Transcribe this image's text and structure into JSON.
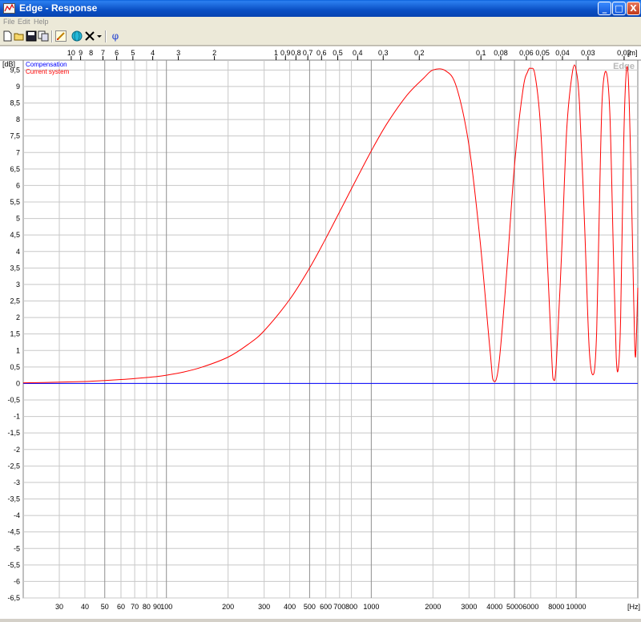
{
  "window": {
    "title": "Edge - Response",
    "min_label": "_",
    "max_label": "□",
    "close_label": "X"
  },
  "menu": {
    "items": [
      "File",
      "Edit",
      "Help"
    ]
  },
  "toolbar": {
    "icons": [
      "new-file-icon",
      "open-folder-icon",
      "save-icon",
      "copy-icon",
      "pencil-icon",
      "globe-icon",
      "cross-icon",
      "dropdown-arrow-icon",
      "phi-icon"
    ],
    "phi_label": "φ"
  },
  "colors": {
    "compensation": "#0000ff",
    "current": "#ff0000",
    "grid": "#c8c8c8",
    "grid_major": "#909090"
  },
  "chart_data": {
    "type": "line",
    "watermark": "Edge",
    "x_unit_label": "[Hz]",
    "y_unit_label": "[dB]",
    "top_unit_label": "[m]",
    "xscale": "log",
    "xlim": [
      20,
      20000
    ],
    "ylim": [
      -6.5,
      9.8
    ],
    "grid": true,
    "legend_position": "top-left",
    "legend": [
      "Compensation",
      "Current system"
    ],
    "x_ticks": [
      30,
      40,
      50,
      60,
      70,
      80,
      90,
      100,
      200,
      300,
      400,
      500,
      600,
      700,
      800,
      1000,
      2000,
      3000,
      4000,
      5000,
      6000,
      8000,
      10000
    ],
    "x_tick_labels": [
      "30",
      "40",
      "50",
      "60",
      "70",
      "80",
      "90",
      "100",
      "200",
      "300",
      "400",
      "500",
      "600",
      "700",
      "800",
      "1000",
      "2000",
      "3000",
      "4000",
      "5000",
      "6000",
      "8000",
      "10000"
    ],
    "y_ticks": [
      -6.5,
      -6,
      -5.5,
      -5,
      -4.5,
      -4,
      -3.5,
      -3,
      -2.5,
      -2,
      -1.5,
      -1,
      -0.5,
      0,
      0.5,
      1,
      1.5,
      2,
      2.5,
      3,
      3.5,
      4,
      4.5,
      5,
      5.5,
      6,
      6.5,
      7,
      7.5,
      8,
      8.5,
      9,
      9.5
    ],
    "y_tick_labels": [
      "-6,5",
      "-6",
      "-5,5",
      "-5",
      "-4,5",
      "-4",
      "-3,5",
      "-3",
      "-2,5",
      "-2",
      "-1,5",
      "-1",
      "-0,5",
      "0",
      "0,5",
      "1",
      "1,5",
      "2",
      "2,5",
      "3",
      "3,5",
      "4",
      "4,5",
      "5",
      "5,5",
      "6",
      "6,5",
      "7",
      "7,5",
      "8",
      "8,5",
      "9",
      "9,5"
    ],
    "top_axis": {
      "ticks_m": [
        10,
        9,
        7,
        6,
        5,
        4,
        3,
        2,
        1,
        0.9,
        0.8,
        0.7,
        0.6,
        0.5,
        0.4,
        0.3,
        0.2,
        0.1,
        0.08,
        0.06,
        0.05,
        0.04,
        0.03,
        0.02
      ],
      "labels": [
        "10",
        "9",
        "8",
        "7",
        "6",
        "5",
        "4",
        "3",
        "2",
        "1",
        "0,9",
        "0,8",
        "0,7",
        "0,6",
        "0,5",
        "0,4",
        "0,3",
        "0,2",
        "0,1",
        "0,08",
        "0,06",
        "0,05",
        "0,04",
        "0,03",
        "0,02"
      ],
      "label_positions_m": [
        10,
        9,
        8,
        7,
        6,
        5,
        4,
        3,
        2,
        1,
        0.9,
        0.8,
        0.7,
        0.6,
        0.5,
        0.4,
        0.3,
        0.2,
        0.1,
        0.08,
        0.06,
        0.05,
        0.04,
        0.03,
        0.02
      ]
    },
    "series": [
      {
        "name": "Compensation",
        "x": [
          20,
          20000
        ],
        "y": [
          0,
          0
        ]
      },
      {
        "name": "Current system",
        "x": [
          20,
          30,
          40,
          50,
          60,
          70,
          80,
          90,
          100,
          120,
          150,
          200,
          250,
          300,
          400,
          500,
          600,
          700,
          800,
          1000,
          1200,
          1500,
          1800,
          2000,
          2300,
          2600,
          3000,
          3400,
          3800,
          3950,
          4200,
          4600,
          5000,
          5500,
          5800,
          6000,
          6300,
          6700,
          7200,
          7600,
          7750,
          8000,
          8500,
          9000,
          9600,
          10000,
          10400,
          11000,
          11600,
          12200,
          12600,
          13000,
          13400,
          14000,
          14600,
          15200,
          15700,
          16100,
          16500,
          17000,
          17500,
          18000,
          18600,
          19100,
          19500,
          20000
        ],
        "y": [
          0.02,
          0.04,
          0.06,
          0.09,
          0.12,
          0.15,
          0.18,
          0.21,
          0.25,
          0.34,
          0.5,
          0.8,
          1.18,
          1.6,
          2.55,
          3.5,
          4.4,
          5.2,
          5.9,
          7.05,
          7.9,
          8.75,
          9.25,
          9.5,
          9.48,
          9.0,
          7.2,
          4.3,
          1.0,
          0.08,
          0.6,
          3.5,
          6.6,
          8.9,
          9.45,
          9.55,
          9.35,
          7.8,
          4.0,
          0.8,
          0.12,
          0.6,
          4.0,
          7.7,
          9.45,
          9.5,
          8.4,
          4.8,
          1.0,
          0.3,
          1.6,
          5.5,
          8.6,
          9.45,
          8.2,
          4.0,
          0.8,
          0.5,
          2.0,
          6.8,
          9.3,
          9.2,
          6.0,
          2.5,
          0.8,
          2.9
        ]
      }
    ]
  }
}
